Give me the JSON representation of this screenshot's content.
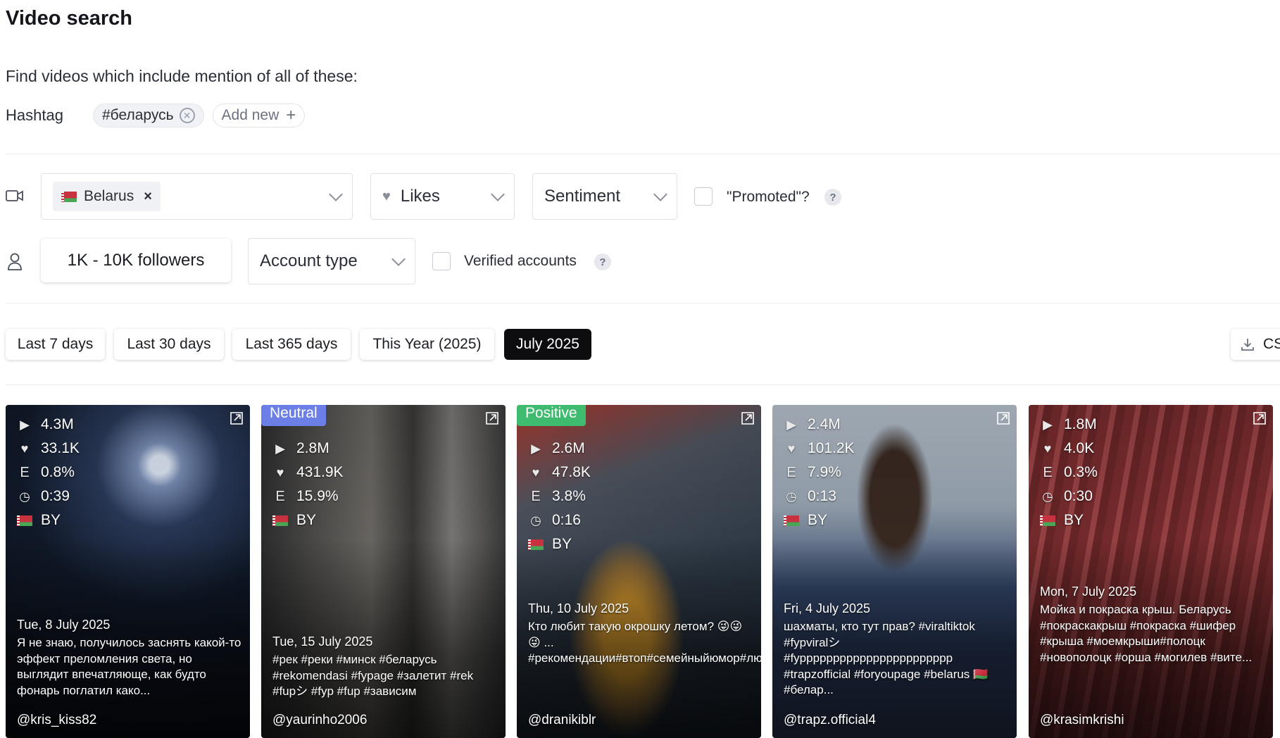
{
  "page": {
    "title": "Video search",
    "subtitle": "Find videos which include mention of all of these:"
  },
  "hashtags": {
    "label": "Hashtag",
    "items": [
      "#беларусь"
    ],
    "add_label": "Add new"
  },
  "video_filters": {
    "country": {
      "selected": "Belarus"
    },
    "likes": {
      "label": "Likes"
    },
    "sentiment": {
      "label": "Sentiment"
    },
    "promoted": {
      "label": "\"Promoted\"?",
      "checked": false
    },
    "help": "?"
  },
  "account_filters": {
    "followers": "1K - 10K followers",
    "account_type": {
      "label": "Account type"
    },
    "verified": {
      "label": "Verified accounts",
      "checked": false
    },
    "help": "?"
  },
  "date_ranges": {
    "items": [
      "Last 7 days",
      "Last 30 days",
      "Last 365 days",
      "This Year (2025)",
      "July 2025"
    ],
    "active": "July 2025",
    "export_label": "CSV"
  },
  "videos": [
    {
      "badge": "",
      "views": "4.3M",
      "likes": "33.1K",
      "engagement": "0.8%",
      "duration": "0:39",
      "country": "BY",
      "date": "Tue, 8 July 2025",
      "description": "Я не знаю, получилось заснять какой-то эффект преломления света, но выглядит впечатляюще, как будто фонарь поглатил како...",
      "author": "@kris_kiss82"
    },
    {
      "badge": "Neutral",
      "views": "2.8M",
      "likes": "431.9K",
      "engagement": "15.9%",
      "duration": "",
      "country": "BY",
      "date": "Tue, 15 July 2025",
      "description": "#рек #реки #минск #беларусь #rekomendasi #fypage #залетит #rek #fupシ #fyp #fup #зависим",
      "author": "@yaurinho2006"
    },
    {
      "badge": "Positive",
      "views": "2.6M",
      "likes": "47.8K",
      "engagement": "3.8%",
      "duration": "0:16",
      "country": "BY",
      "date": "Thu, 10 July 2025",
      "description": "Кто любит такую окрошку летом? 😜😜😜 ... #рекомендации#втоп#семейныйюмор#любовь#окрошка#кухни#беларусь#речица#гомель",
      "author": "@dranikiblr"
    },
    {
      "badge": "",
      "views": "2.4M",
      "likes": "101.2K",
      "engagement": "7.9%",
      "duration": "0:13",
      "country": "BY",
      "date": "Fri, 4 July 2025",
      "description": "шахматы, кто тут прав? #viraltiktok #fypviralシ #fyppppppppppppppppppppppp #trapzofficial #foryoupage #belarus 🇧🇾 #белар...",
      "author": "@trapz.official4"
    },
    {
      "badge": "",
      "views": "1.8M",
      "likes": "4.0K",
      "engagement": "0.3%",
      "duration": "0:30",
      "country": "BY",
      "date": "Mon, 7 July 2025",
      "description": "Мойка и покраска крыш. Беларусь #покраскакрыш #покраска #шифер #крыша #моемкрыши#полоцк #новополоцк #орша #могилев #вите...",
      "author": "@krasimkrishi"
    }
  ],
  "colors": {
    "neutral_badge": "#6b7fe6",
    "positive_badge": "#3fbb6f",
    "active_range": "#0d0d10"
  }
}
